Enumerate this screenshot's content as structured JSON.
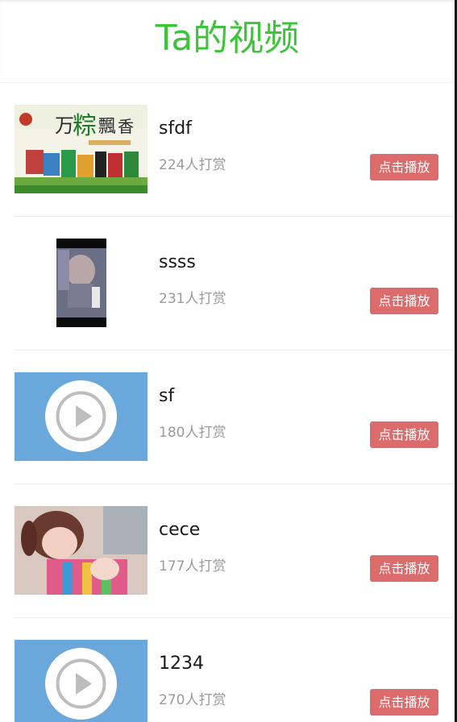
{
  "header": {
    "title": "Ta的视频"
  },
  "videos": [
    {
      "name": "sfdf",
      "reward": "224人打赏",
      "button": "点击播放",
      "thumb": "festival-banner"
    },
    {
      "name": "ssss",
      "reward": "231人打赏",
      "button": "点击播放",
      "thumb": "portrait-photo"
    },
    {
      "name": "sf",
      "reward": "180人打赏",
      "button": "点击播放",
      "thumb": "play-placeholder"
    },
    {
      "name": "cece",
      "reward": "177人打赏",
      "button": "点击播放",
      "thumb": "girl-photo"
    },
    {
      "name": "1234",
      "reward": "270人打赏",
      "button": "点击播放",
      "thumb": "play-placeholder"
    }
  ],
  "colors": {
    "title": "#3ec43a",
    "button": "#dc6b6b",
    "placeholder": "#6aa8dc"
  }
}
